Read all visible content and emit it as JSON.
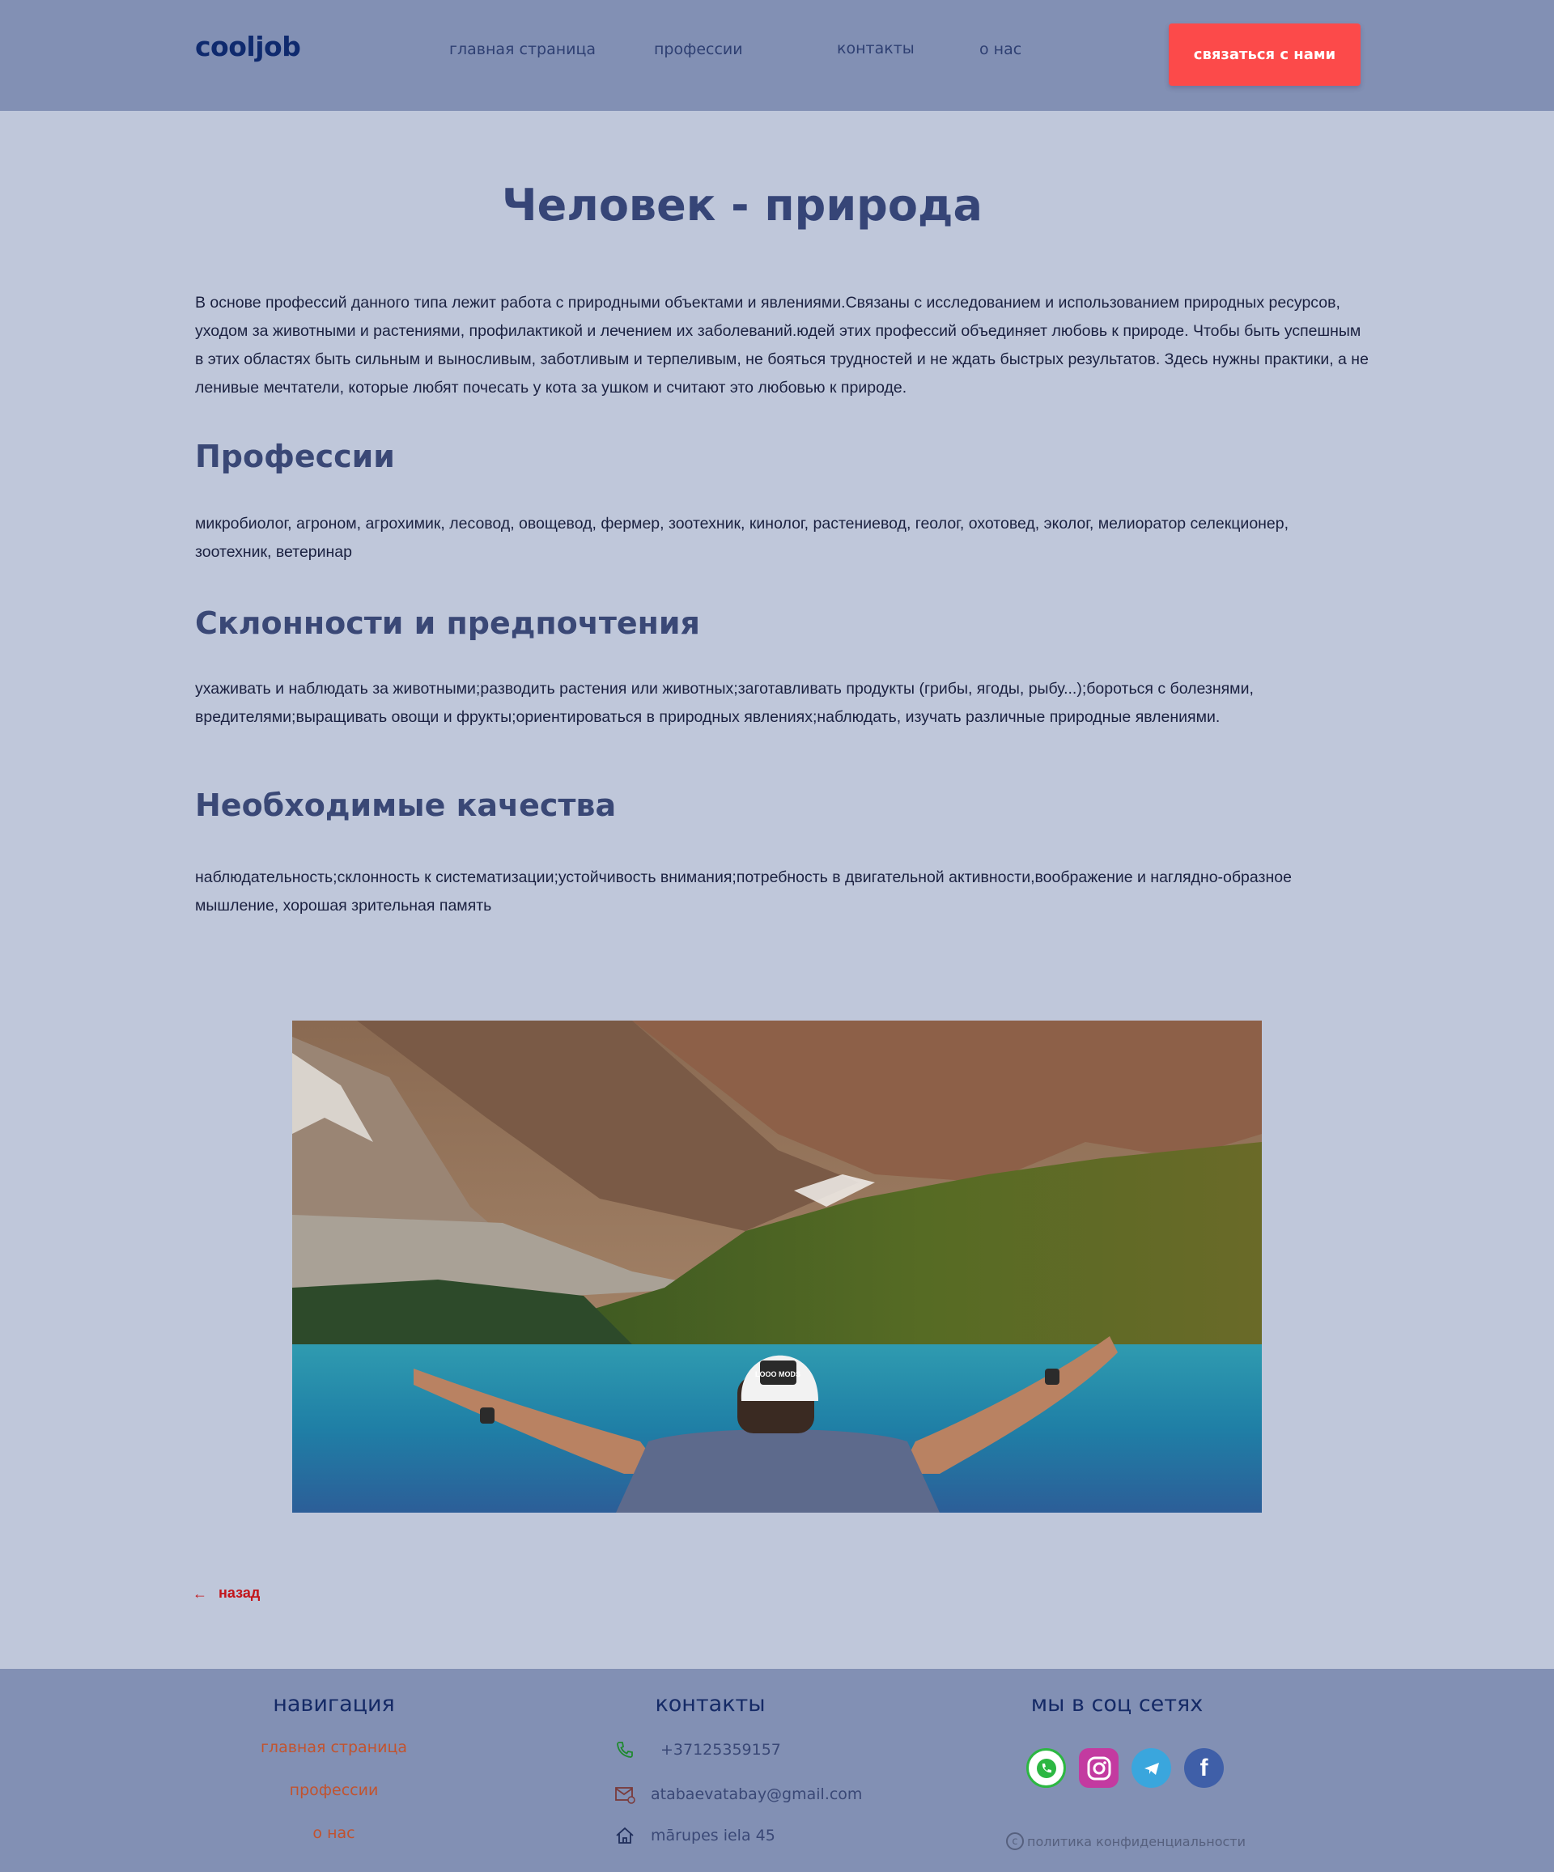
{
  "header": {
    "logo": "cooljob",
    "nav": {
      "home": "главная страница",
      "professions": "профессии",
      "contacts": "контакты",
      "about": "о нас"
    },
    "cta_label": "связаться с нами"
  },
  "main": {
    "title": "Человек - природа",
    "intro": "В основе профессий данного типа лежит работа с природными объектами и явлениями.Связаны с исследованием и использованием природных ресурсов, уходом за животными и растениями, профилактикой и лечением их заболеваний.юдей этих профессий объединяет любовь к природе. Чтобы быть успешным в этих областях быть сильным и выносливым, заботливым и терпеливым, не бояться трудностей и не ждать быстрых результатов. Здесь нужны практики, а не ленивые мечтатели, которые любят почесать у кота за ушком и считают это любовью к природе.",
    "sections": [
      {
        "heading": "Профессии",
        "text": "микробиолог, агроном, агрохимик, лесовод, овощевод, фермер, зоотехник, кинолог, растениевод, геолог, охотовед, эколог, мелиоратор селекционер, зоотехник, ветеринар"
      },
      {
        "heading": "Склонности и предпочтения",
        "text": "ухаживать и наблюдать за животными;разводить растения или животных;заготавливать продукты (грибы, ягоды, рыбу...);бороться с болезнями, вредителями;выращивать овощи и фрукты;ориентироваться в природных явлениях;наблюдать, изучать различные природные явлениями."
      },
      {
        "heading": "Необходимые качества",
        "text": "наблюдательность;склонность к систематизации;устойчивость внимания;потребность в двигательной активности,воображение и наглядно-образное мышление, хорошая зрительная память"
      }
    ],
    "hero_cap_text": "LOOO MODS",
    "back_label": "назад"
  },
  "footer": {
    "nav_heading": "навигация",
    "nav_links": [
      "главная страница",
      "профессии",
      "о нас"
    ],
    "contacts_heading": "контакты",
    "phone": "+37125359157",
    "email": "atabaevatabay@gmail.com",
    "address": "mārupes iela 45",
    "social_heading": "мы в соц сетях",
    "social": [
      "whatsapp-icon",
      "instagram-icon",
      "telegram-icon",
      "facebook-icon"
    ],
    "privacy_label": "политика конфиденциальности"
  },
  "colors": {
    "header_bg": "#8290b4",
    "page_bg": "#bfc7da",
    "cta": "#fc4a4a",
    "heading": "#364577",
    "footer_link": "#c2532e",
    "back_link": "#c3161b"
  }
}
